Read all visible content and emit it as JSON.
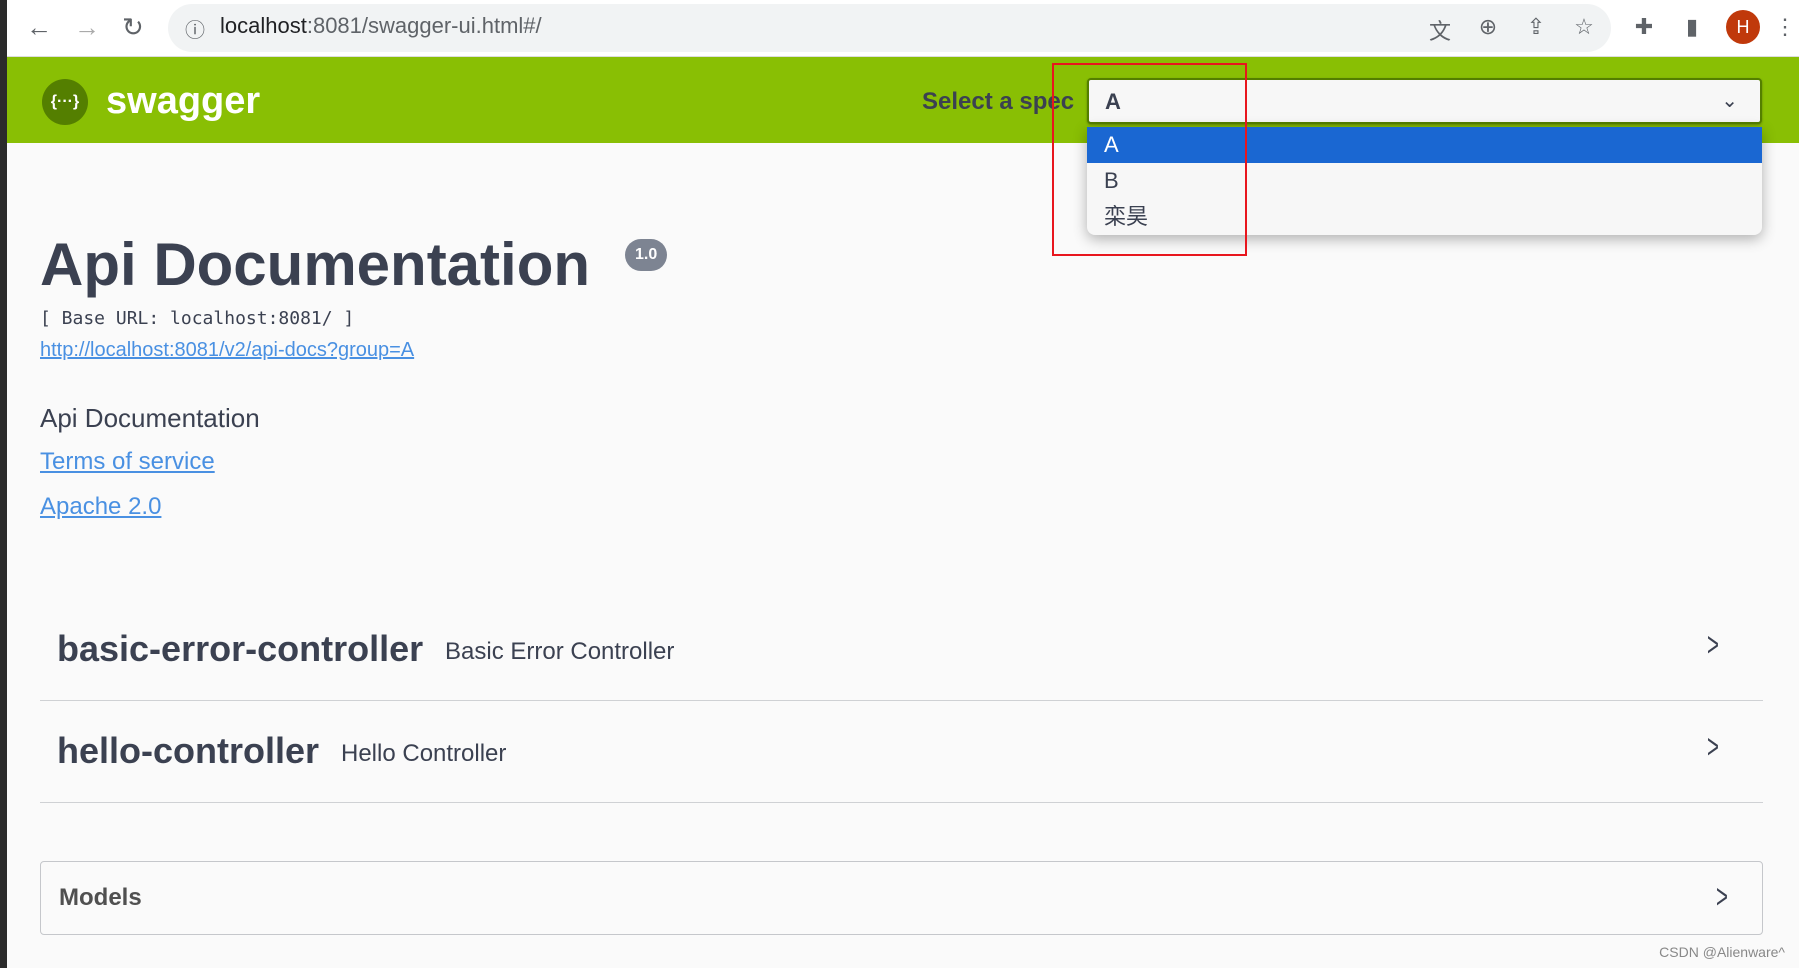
{
  "browser": {
    "url_host": "localhost",
    "url_rest": ":8081/swagger-ui.html#/",
    "avatar_letter": "H"
  },
  "header": {
    "brand": "swagger",
    "logo_glyph": "{···}",
    "spec_label": "Select a spec",
    "selected": "A",
    "options": [
      "A",
      "B",
      "栾昊"
    ]
  },
  "info": {
    "title": "Api Documentation",
    "version": "1.0",
    "base_url": "[ Base URL: localhost:8081/ ]",
    "docs_link": "http://localhost:8081/v2/api-docs?group=A",
    "description": "Api Documentation",
    "terms": "Terms of service",
    "license": "Apache 2.0"
  },
  "tags": [
    {
      "name": "basic-error-controller",
      "description": "Basic Error Controller"
    },
    {
      "name": "hello-controller",
      "description": "Hello Controller"
    }
  ],
  "models": {
    "label": "Models"
  },
  "watermark": "CSDN @Alienware^",
  "colors": {
    "topbar": "#89bf04",
    "selected_option": "#1a67d2",
    "link": "#4990e2",
    "highlight_box": "#e8161e"
  }
}
